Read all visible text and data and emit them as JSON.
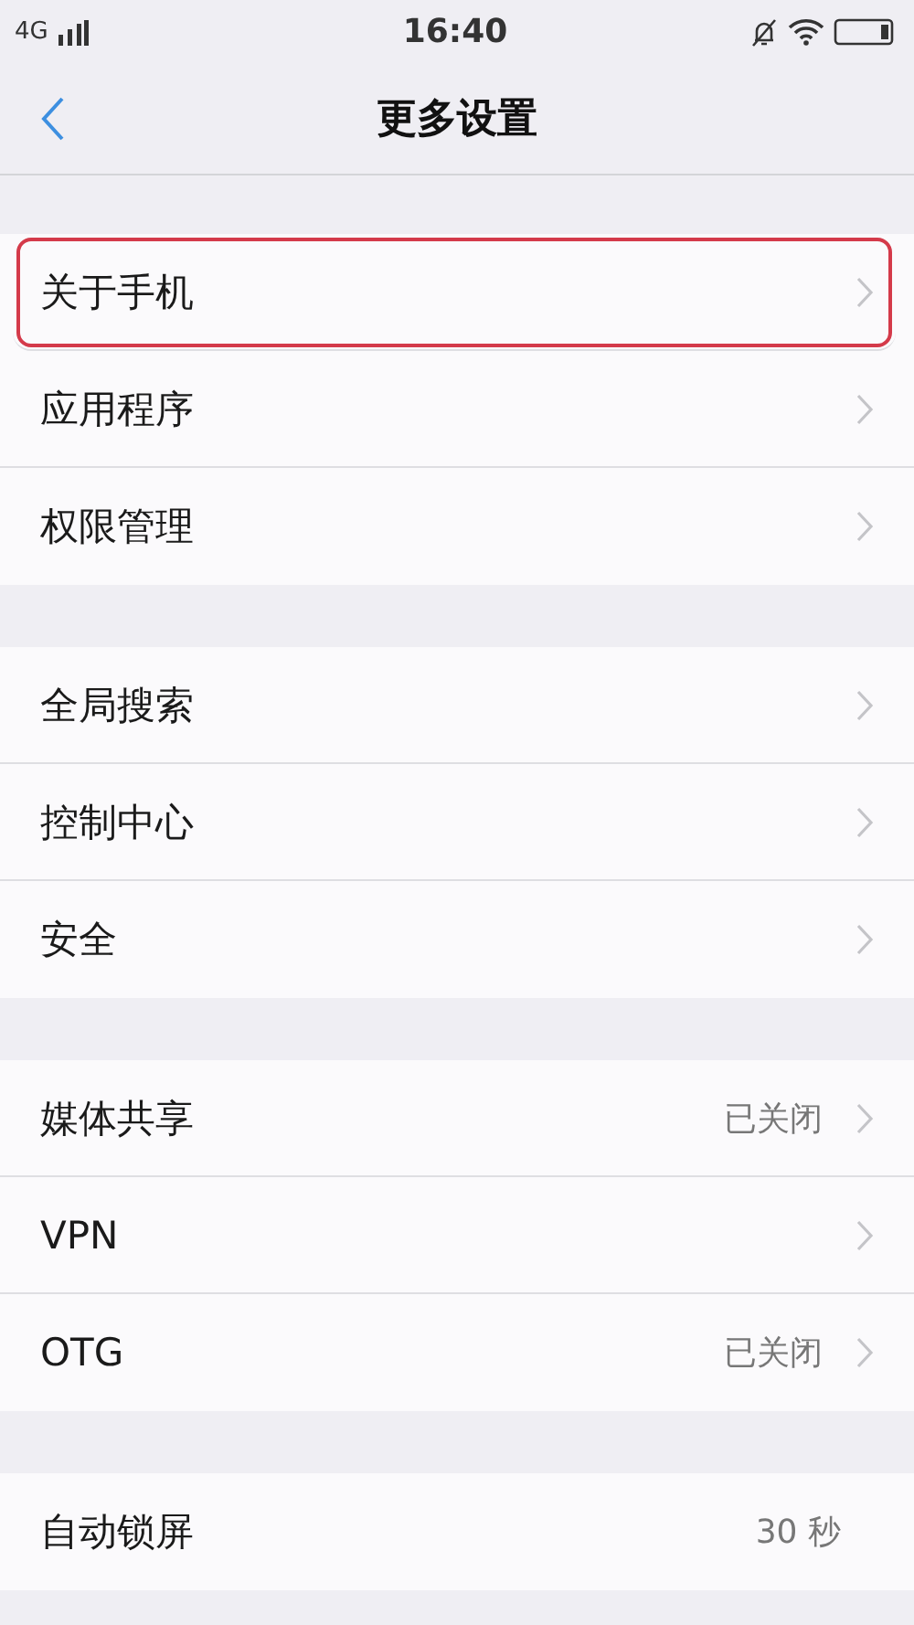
{
  "status_bar": {
    "network": "4G",
    "time": "16:40"
  },
  "header": {
    "title": "更多设置"
  },
  "groups": [
    {
      "items": [
        {
          "label": "关于手机",
          "highlighted": true,
          "chevron": true
        },
        {
          "label": "应用程序",
          "highlighted": false,
          "chevron": true
        },
        {
          "label": "权限管理",
          "highlighted": false,
          "chevron": true
        }
      ]
    },
    {
      "items": [
        {
          "label": "全局搜索",
          "highlighted": false,
          "chevron": true
        },
        {
          "label": "控制中心",
          "highlighted": false,
          "chevron": true
        },
        {
          "label": "安全",
          "highlighted": false,
          "chevron": true
        }
      ]
    },
    {
      "items": [
        {
          "label": "媒体共享",
          "value": "已关闭",
          "highlighted": false,
          "chevron": true
        },
        {
          "label": "VPN",
          "highlighted": false,
          "chevron": true
        },
        {
          "label": "OTG",
          "value": "已关闭",
          "highlighted": false,
          "chevron": true
        }
      ]
    },
    {
      "items": [
        {
          "label": "自动锁屏",
          "value": "30 秒",
          "highlighted": false,
          "chevron": false
        }
      ]
    }
  ]
}
